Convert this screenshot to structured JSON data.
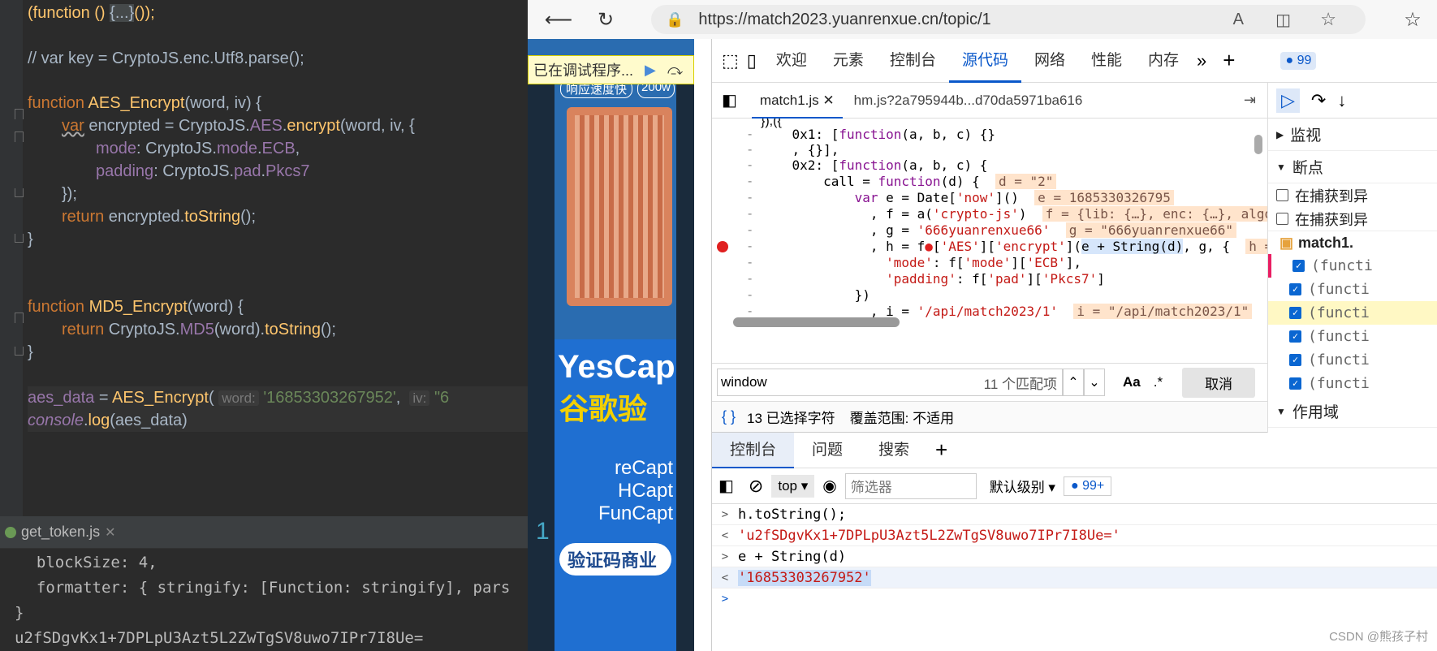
{
  "editor": {
    "lines": {
      "l1_a": "(function () ",
      "l1_fold": "{...}",
      "l1_b": "());",
      "l2": "// var key = CryptoJS.enc.Utf8.parse();",
      "aes_fn": "function",
      "aes_name": "AES_Encrypt",
      "aes_params": "(word, iv) {",
      "enc_var": "var",
      "enc_rest_a": " encrypted = CryptoJS.",
      "enc_aes": "AES",
      "enc_dot": ".",
      "enc_fn": "encrypt",
      "enc_rest_b": "(word, iv, {",
      "mode_a": "mode",
      "mode_b": ": CryptoJS.",
      "mode_c": "mode",
      "mode_d": ".",
      "mode_e": "ECB",
      "mode_f": ",",
      "pad_a": "padding",
      "pad_b": ": CryptoJS.",
      "pad_c": "pad",
      "pad_d": ".",
      "pad_e": "Pkcs7",
      "close1": "});",
      "ret_kw": "return",
      "ret_rest_a": " encrypted.",
      "ret_fn": "toString",
      "ret_rest_b": "();",
      "brace": "}",
      "md5_fn": "function",
      "md5_name": "MD5_Encrypt",
      "md5_params": "(word) {",
      "md5_ret": "return",
      "md5_a": " CryptoJS.",
      "md5_b": "MD5",
      "md5_c": "(word).",
      "md5_d": "toString",
      "md5_e": "();",
      "brace2": "}",
      "aesdata_a": "aes_data",
      "aesdata_b": " = ",
      "aesdata_fn": "AES_Encrypt",
      "aesdata_c": "(",
      "hint_word": "word:",
      "aesdata_str": "'16853303267952'",
      "aesdata_d": ",",
      "hint_iv": "iv:",
      "aesdata_e": "\"6",
      "log_a": "console",
      "log_b": ".",
      "log_c": "log",
      "log_d": "(aes_data)"
    }
  },
  "run": {
    "tab": "get_token.js",
    "out1": "  blockSize: 4,",
    "out2": "  formatter: { stringify: [Function: stringify], pars",
    "out3": "}",
    "out4": "u2fSDgvKx1+7DPLpU3Azt5L2ZwTgSV8uwo7IPr7I8Ue=",
    "gutter_num": "1"
  },
  "browser": {
    "url": "https://match2023.yuanrenxue.cn/topic/1",
    "debug_label": "已在调试程序...",
    "page_text1": "响应速度快",
    "page_text2": "200w",
    "page_ad1": "YesCap",
    "page_ad2": "谷歌验",
    "page_ad3": "reCapt",
    "page_ad4": "HCapt",
    "page_ad5": "FunCapt",
    "page_ad6": "验证码商业"
  },
  "devtools": {
    "tabs": [
      "欢迎",
      "元素",
      "控制台",
      "源代码",
      "网络",
      "性能",
      "内存"
    ],
    "active_tab": "源代码",
    "badge": "99",
    "src_tab1": "match1.js",
    "src_tab2": "hm.js?2a795944b...d70da5971ba616",
    "code": {
      "c0": "}),({",
      "c1a": "    0x1: [",
      "c1b": "function",
      "c1c": "(a, b, c) {}",
      "c2": "    , {}],",
      "c3a": "    0x2: [",
      "c3b": "function",
      "c3c": "(a, b, c) {",
      "c4a": "        call = ",
      "c4b": "function",
      "c4c": "(d) {",
      "c4i": "d = \"2\"",
      "c5a": "            var",
      "c5b": " e = Date[",
      "c5c": "'now'",
      "c5d": "]()",
      "c5i": "e = 1685330326795",
      "c6a": "              , f = a(",
      "c6b": "'crypto-js'",
      "c6c": ")",
      "c6i": "f = {lib: {…}, enc: {…}, algo: {…",
      "c7a": "              , g = ",
      "c7b": "'666yuanrenxue66'",
      "c7i": "g = \"666yuanrenxue66\"",
      "c8a": "              , h = f",
      "c8b": "[",
      "c8c": "'AES'",
      "c8d": "][",
      "c8e": "'encrypt'",
      "c8f": "](",
      "c8g": "e + ",
      "c8h": "String(d)",
      "c8j": ", g, {",
      "c8i": "h =",
      "c9a": "                ",
      "c9b": "'mode'",
      "c9c": ": f[",
      "c9d": "'mode'",
      "c9e": "][",
      "c9f": "'ECB'",
      "c9g": "],",
      "c10a": "                ",
      "c10b": "'padding'",
      "c10c": ": f[",
      "c10d": "'pad'",
      "c10e": "][",
      "c10f": "'Pkcs7'",
      "c10g": "]",
      "c11": "            })",
      "c12a": "              , i = ",
      "c12b": "'/api/match2023/1'",
      "c12i": "i = \"/api/match2023/1\""
    },
    "search_value": "window",
    "search_count": "11 个匹配项",
    "search_aa": "Aa",
    "search_regex": ".*",
    "search_cancel": "取消",
    "status_braces": "{ }",
    "status_sel": "13 已选择字符",
    "status_cov": "覆盖范围: 不适用",
    "right": {
      "watch": "监视",
      "breakpoints": "断点",
      "pause1": "在捕获到异",
      "pause2": "在捕获到异",
      "file": "match1.",
      "items": [
        "(functi",
        "(functi",
        "(functi",
        "(functi",
        "(functi",
        "(functi"
      ],
      "scope": "作用域"
    },
    "console": {
      "tabs": [
        "控制台",
        "问题",
        "搜索"
      ],
      "context": "top",
      "filter_placeholder": "筛选器",
      "level": "默认级别",
      "badge": "99+",
      "lines": [
        {
          "dir": ">",
          "text": "h.toString();"
        },
        {
          "dir": "<",
          "text": "'u2fSDgvKx1+7DPLpU3Azt5L2ZwTgSV8uwo7IPr7I8Ue='"
        },
        {
          "dir": ">",
          "text": "e + String(d)"
        },
        {
          "dir": "<",
          "text": "'16853303267952'"
        }
      ],
      "watermark": "CSDN @熊孩子村"
    }
  }
}
